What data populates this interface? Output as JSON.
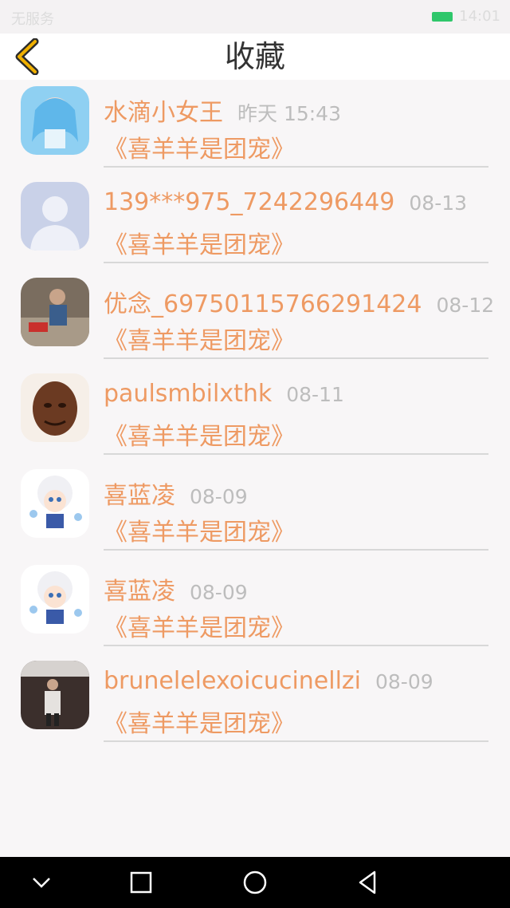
{
  "status_bar": {
    "carrier": "无服务",
    "time": "14:01",
    "battery_color": "#2fc76b"
  },
  "header": {
    "title": "收藏",
    "accent": "#f0b000"
  },
  "items": [
    {
      "name": "水滴小女王",
      "time": "昨天 15:43",
      "message": "《喜羊羊是团宠》",
      "avatar": "anime-girl-avatar"
    },
    {
      "name": "139***975_7242296449",
      "time": "08-13",
      "message": "《喜羊羊是团宠》",
      "avatar": "default-user-avatar"
    },
    {
      "name": "优念_69750115766291424",
      "time": "08-12",
      "message": "《喜羊羊是团宠》",
      "avatar": "child-photo-avatar"
    },
    {
      "name": "paulsmbilxthk",
      "time": "08-11",
      "message": "《喜羊羊是团宠》",
      "avatar": "buddha-statue-avatar"
    },
    {
      "name": "喜蓝凌",
      "time": "08-09",
      "message": "《喜羊羊是团宠》",
      "avatar": "sheep-cartoon-avatar"
    },
    {
      "name": "喜蓝凌",
      "time": "08-09",
      "message": "《喜羊羊是团宠》",
      "avatar": "sheep-cartoon-avatar"
    },
    {
      "name": "brunelelexoicucinellzi",
      "time": "08-09",
      "message": "《喜羊羊是团宠》",
      "avatar": "man-photo-avatar"
    }
  ],
  "nav": {
    "back": "chevron-down-icon",
    "recents": "square-icon",
    "home": "circle-icon",
    "previous": "triangle-back-icon"
  }
}
